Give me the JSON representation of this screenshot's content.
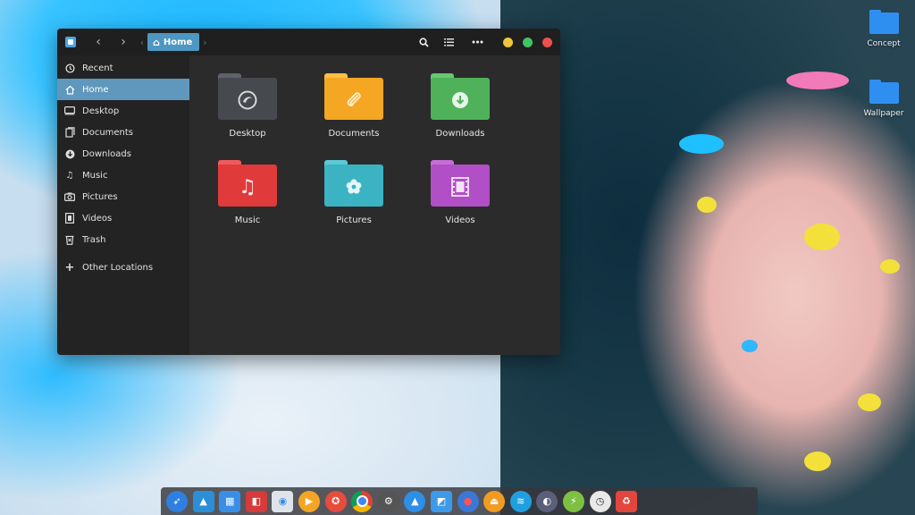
{
  "window": {
    "breadcrumb": {
      "home_label": "Home"
    },
    "controls": {
      "minimize_color": "#f0c53b",
      "maximize_color": "#43c463",
      "close_color": "#ee4f4f"
    }
  },
  "sidebar": {
    "items": [
      {
        "label": "Recent",
        "icon": "clock-icon"
      },
      {
        "label": "Home",
        "icon": "home-icon"
      },
      {
        "label": "Desktop",
        "icon": "desktop-icon"
      },
      {
        "label": "Documents",
        "icon": "document-icon"
      },
      {
        "label": "Downloads",
        "icon": "download-icon"
      },
      {
        "label": "Music",
        "icon": "music-note-icon"
      },
      {
        "label": "Pictures",
        "icon": "camera-icon"
      },
      {
        "label": "Videos",
        "icon": "film-icon"
      },
      {
        "label": "Trash",
        "icon": "trash-icon"
      },
      {
        "label": "Other Locations",
        "icon": "plus-icon"
      }
    ],
    "active": "Home"
  },
  "folders": [
    {
      "label": "Desktop",
      "color": "#4a4d52",
      "icon": "desktop-logo-icon"
    },
    {
      "label": "Documents",
      "color": "#f5a623",
      "icon": "paperclip-icon"
    },
    {
      "label": "Downloads",
      "color": "#4fb15a",
      "icon": "download-arrow-icon"
    },
    {
      "label": "Music",
      "color": "#e03a3a",
      "icon": "music-note-icon"
    },
    {
      "label": "Pictures",
      "color": "#3bb3c3",
      "icon": "flower-icon"
    },
    {
      "label": "Videos",
      "color": "#b04fc6",
      "icon": "film-icon"
    }
  ],
  "desktop_icons": [
    {
      "label": "Concept"
    },
    {
      "label": "Wallpaper"
    }
  ],
  "dock": {
    "apps": [
      {
        "name": "launcher",
        "icon": "rocket-icon",
        "color": "#2f7fe0"
      },
      {
        "name": "image-viewer",
        "icon": "landscape-icon",
        "color": "#2a8fd6"
      },
      {
        "name": "multitasking",
        "icon": "windows-icon",
        "color": "#3a8ee8"
      },
      {
        "name": "app-store",
        "icon": "bag-icon",
        "color": "#d63a3a"
      },
      {
        "name": "deepin-store",
        "icon": "deepin-icon",
        "color": "#dfe4ea"
      },
      {
        "name": "music-player",
        "icon": "play-icon",
        "color": "#f5a524"
      },
      {
        "name": "video-player",
        "icon": "lifebuoy-icon",
        "color": "#e74c3c"
      },
      {
        "name": "chrome",
        "icon": "chrome-icon",
        "color": "#e9b82c"
      },
      {
        "name": "settings",
        "icon": "gear-icon",
        "color": "#555"
      },
      {
        "name": "terminal",
        "icon": "triangle-icon",
        "color": "#2d8fe5"
      },
      {
        "name": "file-manager",
        "icon": "finder-icon",
        "color": "#3d9ae8"
      },
      {
        "name": "screen-recorder",
        "icon": "record-icon",
        "color": "#3a78d8"
      },
      {
        "name": "eject",
        "icon": "eject-icon",
        "color": "#f29b21"
      },
      {
        "name": "network",
        "icon": "wifi-icon",
        "color": "#1f9fe0"
      },
      {
        "name": "browser",
        "icon": "browser-icon",
        "color": "#5a5f7a"
      },
      {
        "name": "power",
        "icon": "power-icon",
        "color": "#7ec142"
      },
      {
        "name": "clock",
        "icon": "clock-icon",
        "color": "#e9e9e9"
      },
      {
        "name": "trash",
        "icon": "trash-icon",
        "color": "#e2463d"
      }
    ]
  }
}
